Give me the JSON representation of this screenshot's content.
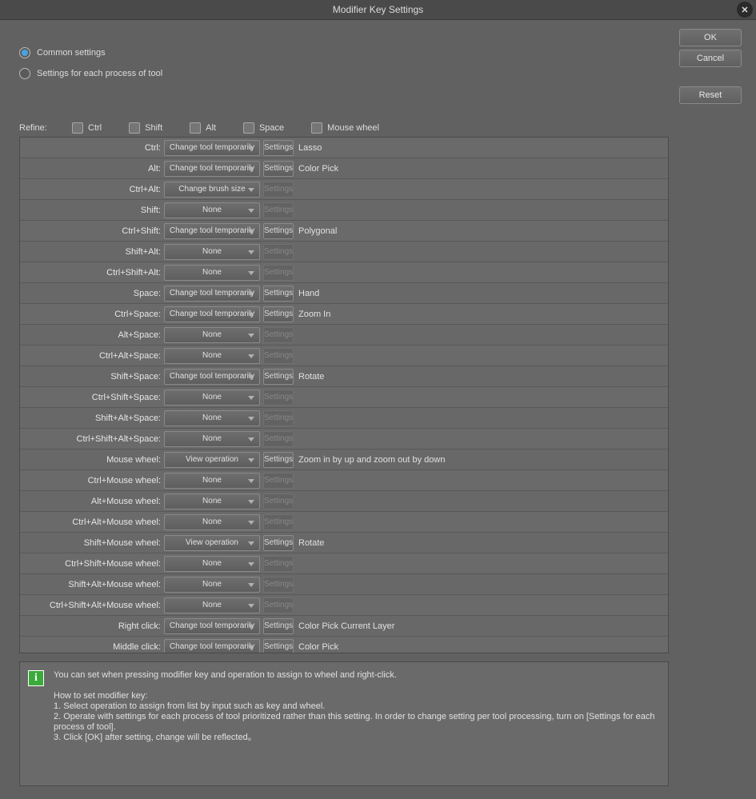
{
  "title": "Modifier Key Settings",
  "buttons": {
    "ok": "OK",
    "cancel": "Cancel",
    "reset": "Reset"
  },
  "radio": {
    "common": "Common settings",
    "per_tool": "Settings for each process of tool"
  },
  "refine": {
    "label": "Refine:",
    "ctrl": "Ctrl",
    "shift": "Shift",
    "alt": "Alt",
    "space": "Space",
    "wheel": "Mouse wheel"
  },
  "settings_label": "Settings",
  "rows": [
    {
      "key": "Ctrl:",
      "op": "Change tool temporarily",
      "enabled": true,
      "desc": "Lasso"
    },
    {
      "key": "Alt:",
      "op": "Change tool temporarily",
      "enabled": true,
      "desc": "Color Pick"
    },
    {
      "key": "Ctrl+Alt:",
      "op": "Change brush size",
      "enabled": false,
      "desc": ""
    },
    {
      "key": "Shift:",
      "op": "None",
      "enabled": false,
      "desc": ""
    },
    {
      "key": "Ctrl+Shift:",
      "op": "Change tool temporarily",
      "enabled": true,
      "desc": "Polygonal"
    },
    {
      "key": "Shift+Alt:",
      "op": "None",
      "enabled": false,
      "desc": ""
    },
    {
      "key": "Ctrl+Shift+Alt:",
      "op": "None",
      "enabled": false,
      "desc": ""
    },
    {
      "key": "Space:",
      "op": "Change tool temporarily",
      "enabled": true,
      "desc": "Hand"
    },
    {
      "key": "Ctrl+Space:",
      "op": "Change tool temporarily",
      "enabled": true,
      "desc": "Zoom In"
    },
    {
      "key": "Alt+Space:",
      "op": "None",
      "enabled": false,
      "desc": ""
    },
    {
      "key": "Ctrl+Alt+Space:",
      "op": "None",
      "enabled": false,
      "desc": ""
    },
    {
      "key": "Shift+Space:",
      "op": "Change tool temporarily",
      "enabled": true,
      "desc": "Rotate"
    },
    {
      "key": "Ctrl+Shift+Space:",
      "op": "None",
      "enabled": false,
      "desc": ""
    },
    {
      "key": "Shift+Alt+Space:",
      "op": "None",
      "enabled": false,
      "desc": ""
    },
    {
      "key": "Ctrl+Shift+Alt+Space:",
      "op": "None",
      "enabled": false,
      "desc": ""
    },
    {
      "key": "Mouse wheel:",
      "op": "View operation",
      "enabled": true,
      "desc": "Zoom in by up and zoom out by down"
    },
    {
      "key": "Ctrl+Mouse wheel:",
      "op": "None",
      "enabled": false,
      "desc": ""
    },
    {
      "key": "Alt+Mouse wheel:",
      "op": "None",
      "enabled": false,
      "desc": ""
    },
    {
      "key": "Ctrl+Alt+Mouse wheel:",
      "op": "None",
      "enabled": false,
      "desc": ""
    },
    {
      "key": "Shift+Mouse wheel:",
      "op": "View operation",
      "enabled": true,
      "desc": "Rotate"
    },
    {
      "key": "Ctrl+Shift+Mouse wheel:",
      "op": "None",
      "enabled": false,
      "desc": ""
    },
    {
      "key": "Shift+Alt+Mouse wheel:",
      "op": "None",
      "enabled": false,
      "desc": ""
    },
    {
      "key": "Ctrl+Shift+Alt+Mouse wheel:",
      "op": "None",
      "enabled": false,
      "desc": ""
    },
    {
      "key": "Right click:",
      "op": "Change tool temporarily",
      "enabled": true,
      "desc": "Color Pick Current Layer"
    },
    {
      "key": "Middle click:",
      "op": "Change tool temporarily",
      "enabled": true,
      "desc": "Color Pick"
    }
  ],
  "info": {
    "l1": "You can set when pressing modifier key and operation to assign to wheel and right-click.",
    "l2": "How to set modifier key:",
    "l3": "1. Select operation to assign from list by input such as key and wheel.",
    "l4": "2. Operate with settings for each process of tool prioritized rather than this setting. In order to change setting per tool processing, turn on [Settings for each process of tool].",
    "l5": "3. Click [OK] after setting, change will be reflected。"
  }
}
